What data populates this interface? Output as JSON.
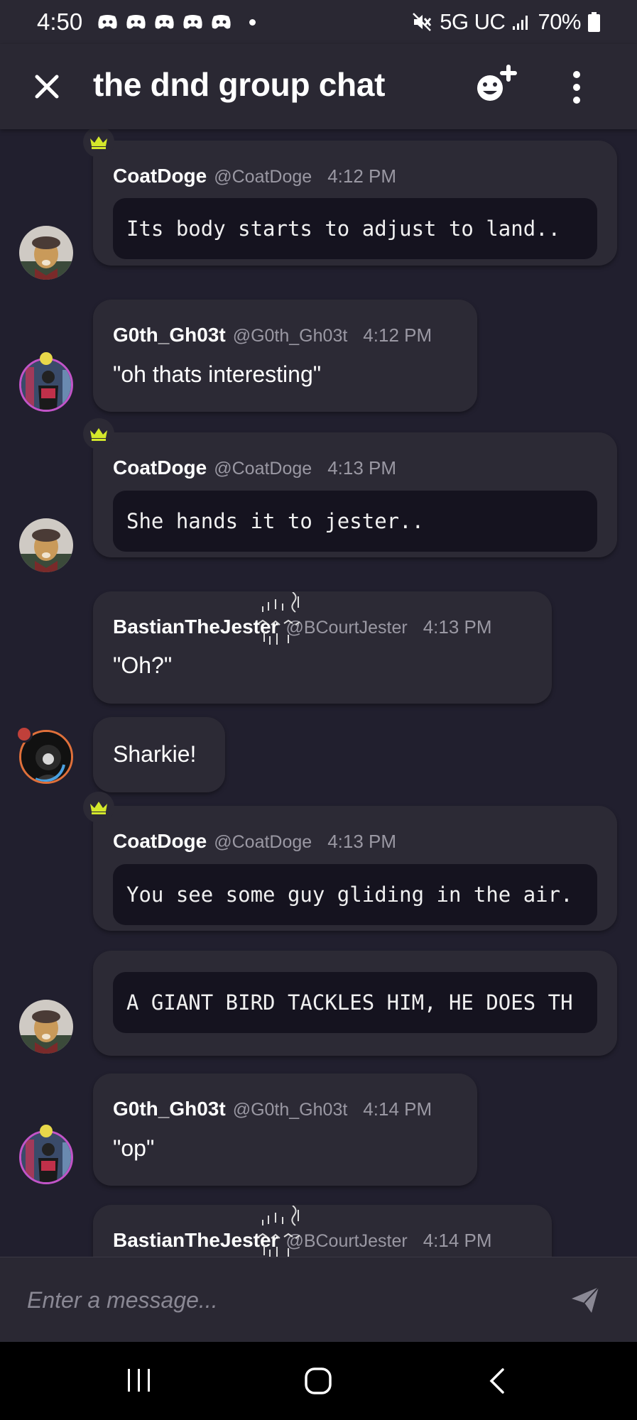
{
  "status_bar": {
    "time": "4:50",
    "network": "5G UC",
    "battery": "70%",
    "notification_icons": [
      "discord-icon",
      "discord-icon",
      "discord-icon",
      "discord-icon",
      "discord-icon"
    ]
  },
  "header": {
    "title": "the dnd group chat",
    "close_icon": "close-icon",
    "add_reaction_icon": "add-emoji-icon",
    "more_icon": "more-vertical-icon"
  },
  "messages": [
    {
      "author": "CoatDoge",
      "handle": "@CoatDoge",
      "time": "4:12 PM",
      "text": "Its body starts to adjust to land..",
      "style": "code",
      "crown": true
    },
    {
      "author": "G0th_Gh03t",
      "handle": "@G0th_Gh03t",
      "time": "4:12 PM",
      "text": "\"oh thats interesting\"",
      "style": "plain"
    },
    {
      "author": "CoatDoge",
      "handle": "@CoatDoge",
      "time": "4:13 PM",
      "text": "She hands it to jester..",
      "style": "code",
      "crown": true
    },
    {
      "author": "BastianTheJester",
      "handle": "@BCourtJester",
      "time": "4:13 PM",
      "text": "\"Oh?\"",
      "style": "plain"
    },
    {
      "author": "",
      "handle": "",
      "time": "",
      "text": "Sharkie!",
      "style": "plain"
    },
    {
      "author": "CoatDoge",
      "handle": "@CoatDoge",
      "time": "4:13 PM",
      "text": "You see some guy gliding in the air.",
      "style": "code",
      "crown": true
    },
    {
      "author": "",
      "handle": "",
      "time": "",
      "text": "A GIANT BIRD TACKLES HIM, HE DOES TH",
      "style": "code"
    },
    {
      "author": "G0th_Gh03t",
      "handle": "@G0th_Gh03t",
      "time": "4:14 PM",
      "text": "\"op\"",
      "style": "plain"
    },
    {
      "author": "BastianTheJester",
      "handle": "@BCourtJester",
      "time": "4:14 PM",
      "text": "",
      "style": "plain"
    }
  ],
  "input": {
    "placeholder": "Enter a message..."
  },
  "nav": {
    "recents_icon": "recents-icon",
    "home_icon": "home-icon",
    "back_icon": "back-icon"
  },
  "colors": {
    "background": "#211f2e",
    "bubble": "#2c2a35",
    "code_block": "#15131f",
    "crown": "#d4e82b",
    "muted_text": "#9a98a3"
  }
}
